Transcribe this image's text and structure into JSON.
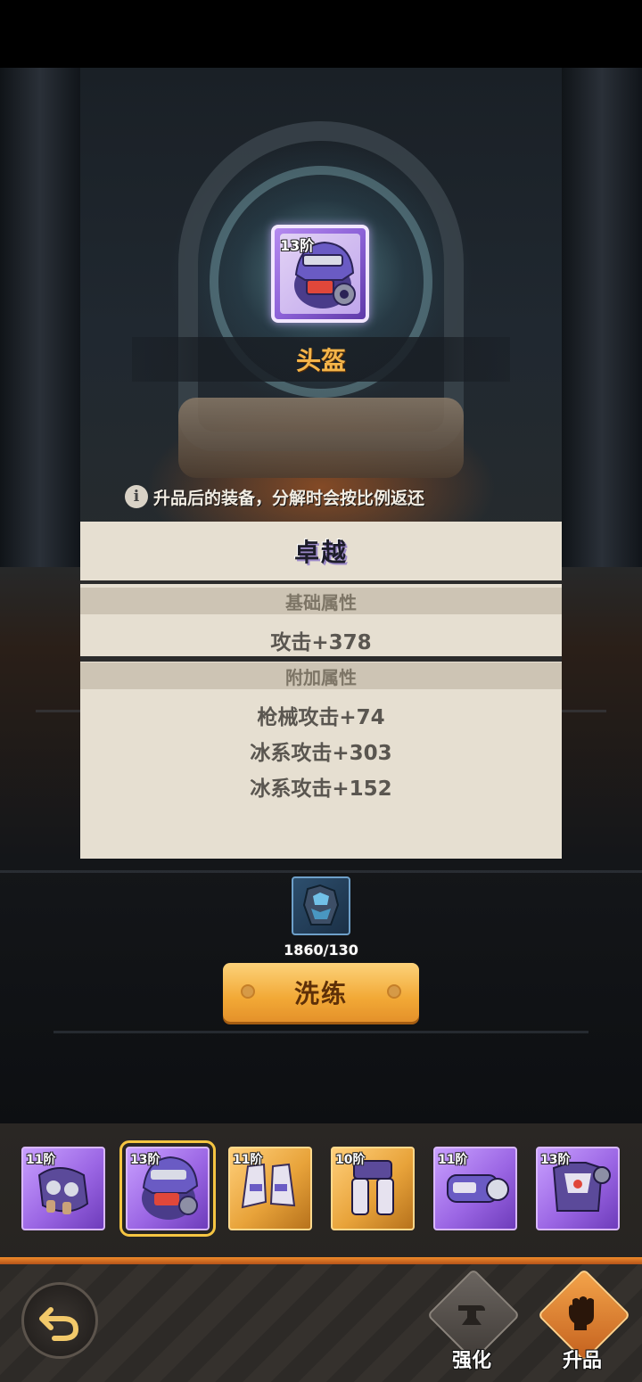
{
  "equipment": {
    "tier": "13阶",
    "name": "头盔"
  },
  "hint": {
    "icon": "info-icon",
    "text": "升品后的装备，分解时会按比例返还"
  },
  "panel": {
    "quality": "卓越",
    "base_header": "基础属性",
    "base_value": "攻击+378",
    "extra_header": "附加属性",
    "extra_values": [
      "枪械攻击+74",
      "冰系攻击+303",
      "冰系攻击+152"
    ]
  },
  "material": {
    "icon": "crystal-armor-icon",
    "count": "1860/130"
  },
  "refine_button": "洗练",
  "slots": [
    {
      "tier": "11阶",
      "item": "gauntlet",
      "rarity": "purple"
    },
    {
      "tier": "13阶",
      "item": "helmet",
      "rarity": "purple",
      "selected": true
    },
    {
      "tier": "11阶",
      "item": "boots",
      "rarity": "gold"
    },
    {
      "tier": "10阶",
      "item": "leg-armor",
      "rarity": "gold"
    },
    {
      "tier": "11阶",
      "item": "arm-cannon",
      "rarity": "purple"
    },
    {
      "tier": "13阶",
      "item": "chest-armor",
      "rarity": "purple"
    }
  ],
  "footer": {
    "enhance_label": "强化",
    "upgrade_label": "升品"
  },
  "colors": {
    "accent_gold": "#f4b54a",
    "button_orange": "#f2a936",
    "panel_bg": "#e6dfd1",
    "rarity_purple": "#9b66e4",
    "rarity_gold": "#e8a33a"
  }
}
